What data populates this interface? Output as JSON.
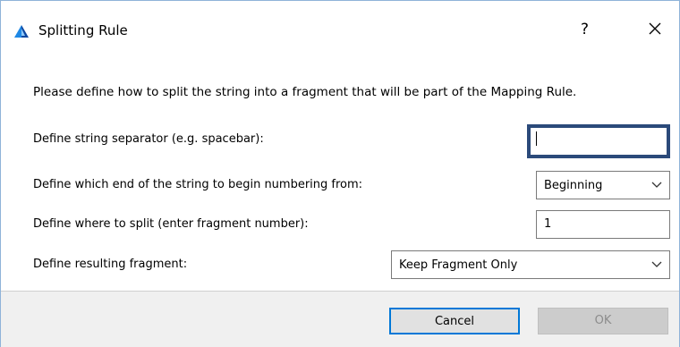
{
  "window": {
    "title": "Splitting Rule",
    "help_label": "?"
  },
  "intro": "Please define how to split the string into a fragment that will be part of the Mapping Rule.",
  "rows": {
    "separator": {
      "label": "Define string separator (e.g. spacebar):",
      "value": ""
    },
    "numbering": {
      "label": "Define which end of the string to begin numbering from:",
      "selected": "Beginning"
    },
    "split": {
      "label": "Define where to split (enter fragment number):",
      "value": "1"
    },
    "result": {
      "label": "Define resulting fragment:",
      "selected": "Keep Fragment Only"
    }
  },
  "buttons": {
    "cancel": "Cancel",
    "ok": "OK"
  },
  "colors": {
    "focus_border": "#2b4a7a",
    "cancel_border": "#0078d7",
    "app_icon": "#1e88e5"
  },
  "icons": {
    "app": "app-logo-icon",
    "close": "close-icon",
    "dropdown": "chevron-down-icon"
  }
}
